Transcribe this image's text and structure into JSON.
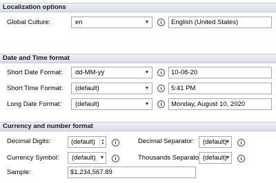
{
  "localization": {
    "header": "Localization options",
    "global_culture_label": "Global Culture:",
    "global_culture_value": "en",
    "global_culture_display": "English (United States)"
  },
  "datetime": {
    "header": "Date and Time format",
    "short_date_label": "Short Date Format:",
    "short_date_value": "dd-MM-yy",
    "short_date_sample": "10-08-20",
    "short_time_label": "Short Time Format:",
    "short_time_value": "(default)",
    "short_time_sample": "5:41 PM",
    "long_date_label": "Long Date Format:",
    "long_date_value": "(default)",
    "long_date_sample": "Monday, August 10, 2020"
  },
  "currency": {
    "header": "Currency and number format",
    "decimal_digits_label": "Decimal Digits:",
    "decimal_digits_value": "(default)",
    "decimal_separator_label": "Decimal Separator:",
    "decimal_separator_value": "(default)",
    "currency_symbol_label": "Currency Symbol:",
    "currency_symbol_value": "(default)",
    "thousands_separator_label": "Thousands Separator:",
    "thousands_separator_value": "(default)",
    "sample_label": "Sample:",
    "sample_value": "$1,234,567.89"
  },
  "icons": {
    "info": "info-icon",
    "dropdown": "chevron-down-icon"
  }
}
